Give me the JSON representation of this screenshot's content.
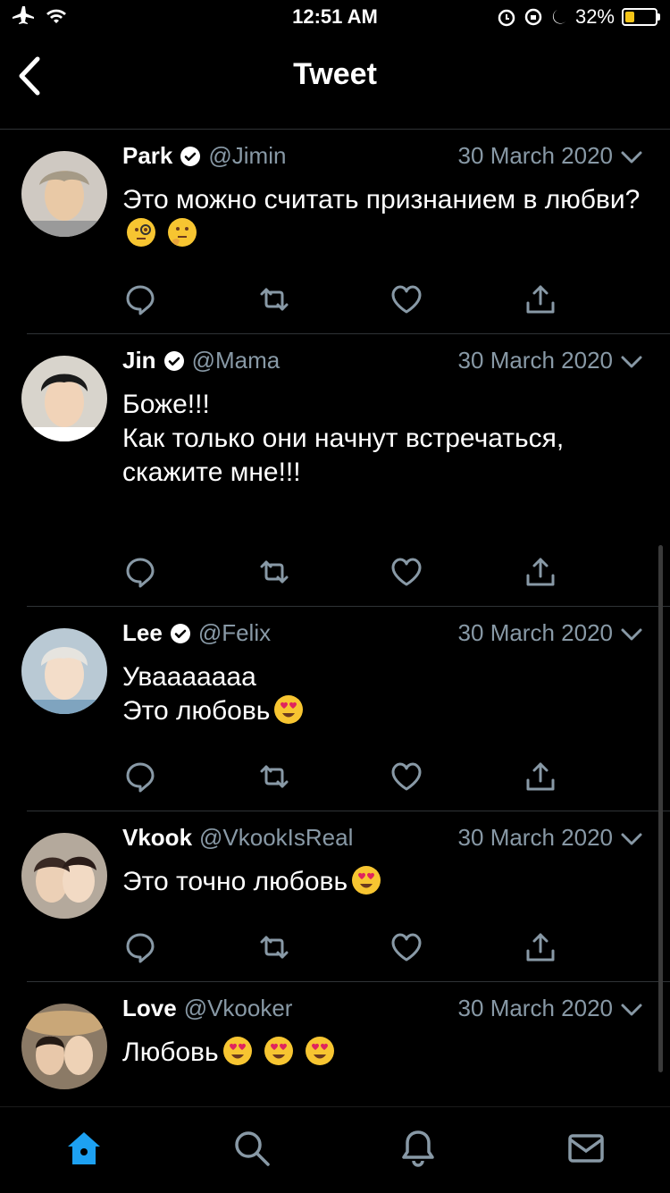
{
  "status_bar": {
    "time": "12:51 AM",
    "battery": "32%",
    "battery_level": 0.32
  },
  "header": {
    "title": "Tweet"
  },
  "colors": {
    "accent": "#1da1f2",
    "secondary_text": "#8899a6",
    "divider": "#2f3336",
    "background": "#000000"
  },
  "tweets": [
    {
      "name": "Park",
      "verified": true,
      "handle": "@Jimin",
      "date": "30 March 2020",
      "text": "Это можно считать признанием в любви?"
    },
    {
      "name": "Jin",
      "verified": true,
      "handle": "@Mama",
      "date": "30 March 2020",
      "text": "Боже!!!\nКак только они начнут встречаться, скажите мне!!!"
    },
    {
      "name": "Lee",
      "verified": true,
      "handle": "@Felix",
      "date": "30 March 2020",
      "text": "Увааааааа\nЭто любовь"
    },
    {
      "name": "Vkook",
      "verified": false,
      "handle": "@VkookIsReal",
      "date": "30 March 2020",
      "text": "Это точно любовь"
    },
    {
      "name": "Love",
      "verified": false,
      "handle": "@Vkooker",
      "date": "30 March 2020",
      "text": "Любовь"
    }
  ],
  "tab_bar": {
    "items": [
      "home-icon",
      "search-icon",
      "notifications-icon",
      "messages-icon"
    ],
    "active": "home-icon"
  }
}
